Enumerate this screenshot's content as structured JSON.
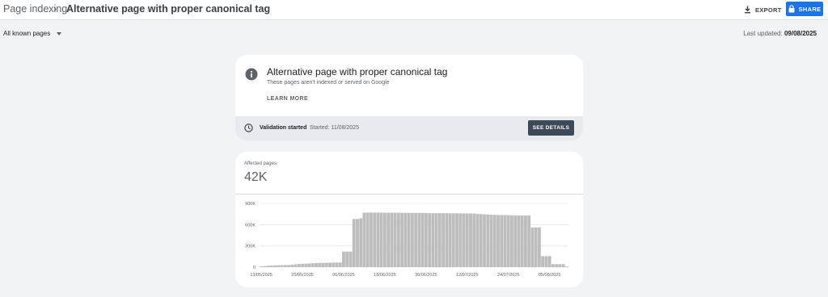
{
  "header": {
    "breadcrumb_root": "Page indexing",
    "breadcrumb_separator": "›",
    "page_title": "Alternative page with proper canonical tag",
    "export_label": "EXPORT",
    "share_label": "SHARE"
  },
  "toolbar": {
    "filter_label": "All known pages",
    "last_updated_label": "Last updated:",
    "last_updated_value": "09/08/2025"
  },
  "issue_card": {
    "title": "Alternative page with proper canonical tag",
    "subtitle": "These pages aren't indexed or served on Google",
    "learn_more": "LEARN MORE",
    "validation_label": "Validation started",
    "validation_date": "Started: 11/08/2025",
    "details_button": "SEE DETAILS"
  },
  "affected": {
    "label": "Affected pages",
    "value": "42K"
  },
  "colors": {
    "accent": "#1a73e8",
    "bar": "#bdbdbd",
    "details_button": "#3c4a57"
  },
  "chart_data": {
    "type": "bar",
    "ylim": [
      0,
      900000
    ],
    "y_ticks": [
      {
        "value": 900000,
        "label": "900K"
      },
      {
        "value": 600000,
        "label": "600K"
      },
      {
        "value": 300000,
        "label": "300K"
      },
      {
        "value": 0,
        "label": "0"
      }
    ],
    "x_tick_labels": [
      {
        "index": 0,
        "label": "13/05/2025"
      },
      {
        "index": 12,
        "label": "25/05/2025"
      },
      {
        "index": 24,
        "label": "06/06/2025"
      },
      {
        "index": 36,
        "label": "18/06/2025"
      },
      {
        "index": 48,
        "label": "30/06/2025"
      },
      {
        "index": 60,
        "label": "12/07/2025"
      },
      {
        "index": 72,
        "label": "24/07/2025"
      },
      {
        "index": 84,
        "label": "05/08/2025"
      }
    ],
    "values": [
      10000,
      15000,
      20000,
      22000,
      25000,
      27000,
      28000,
      30000,
      30000,
      35000,
      40000,
      45000,
      48000,
      50000,
      52000,
      55000,
      58000,
      60000,
      60000,
      62000,
      62000,
      63000,
      65000,
      65000,
      220000,
      220000,
      220000,
      680000,
      680000,
      690000,
      770000,
      770000,
      770000,
      770000,
      770000,
      770000,
      768000,
      768000,
      768000,
      768000,
      768000,
      767000,
      767000,
      765000,
      765000,
      765000,
      765000,
      765000,
      765000,
      763000,
      762000,
      762000,
      762000,
      762000,
      762000,
      761000,
      760000,
      760000,
      759000,
      759000,
      758000,
      757000,
      757000,
      750000,
      748000,
      745000,
      743000,
      740000,
      738000,
      736000,
      735000,
      734000,
      733000,
      732000,
      731000,
      730000,
      730000,
      730000,
      730000,
      560000,
      560000,
      560000,
      155000,
      155000,
      155000,
      42000,
      42000,
      42000,
      42000,
      10000
    ]
  }
}
